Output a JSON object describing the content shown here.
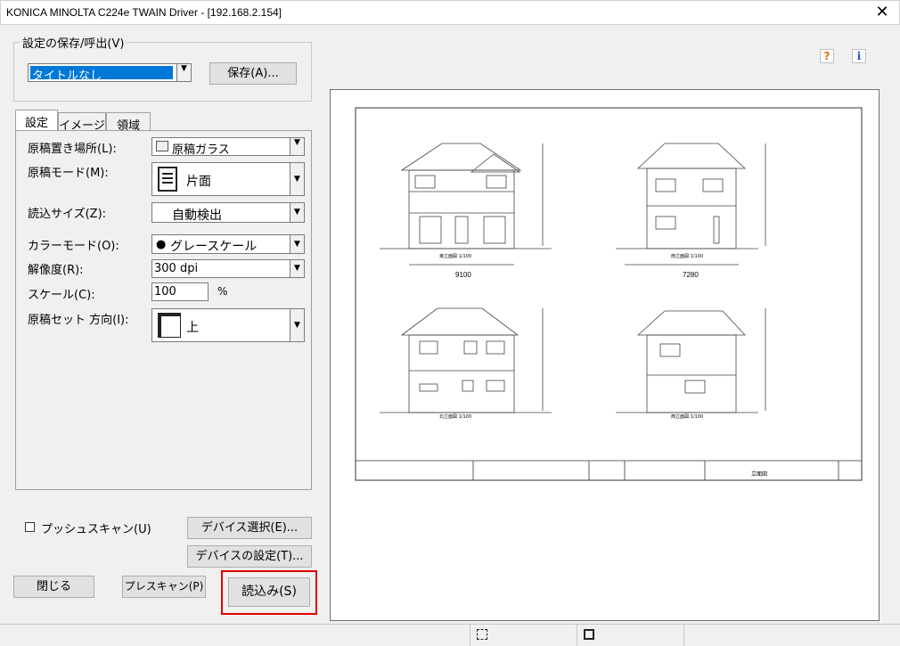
{
  "window": {
    "title": "KONICA MINOLTA C224e TWAIN Driver - [192.168.2.154]"
  },
  "settings_group": {
    "legend": "設定の保存/呼出(V)",
    "preset_value": "タイトルなし",
    "save_button": "保存(A)..."
  },
  "tabs": [
    "設定",
    "イメージ",
    "領域"
  ],
  "fields": {
    "location_label": "原稿置き場所(L):",
    "location_value": "原稿ガラス",
    "mode_label": "原稿モード(M):",
    "mode_value": "片面",
    "size_label": "読込サイズ(Z):",
    "size_value": "自動検出",
    "color_label": "カラーモード(O):",
    "color_value": "グレースケール",
    "resolution_label": "解像度(R):",
    "resolution_value": "300 dpi",
    "scale_label": "スケール(C):",
    "scale_value": "100",
    "scale_unit": "%",
    "orientation_label": "原稿セット 方向(I):",
    "orientation_value": "上"
  },
  "push_scan": {
    "label": "プッシュスキャン(U)"
  },
  "buttons": {
    "device_select": "デバイス選択(E)...",
    "device_settings": "デバイスの設定(T)...",
    "close": "閉じる",
    "prescan": "プレスキャン(P)",
    "scan": "読込み(S)"
  },
  "drawing": {
    "dims": {
      "d1": "9100",
      "d2": "7280"
    },
    "view_titles": {
      "v1": "東立面図 1/100",
      "v2": "南立面図 1/100",
      "v3": "北立面図 1/100",
      "v4": "西立面図 1/100"
    },
    "title_block": {
      "name": "立面図"
    }
  },
  "colors": {
    "accent": "#0078d7",
    "highlight": "#e00000"
  }
}
